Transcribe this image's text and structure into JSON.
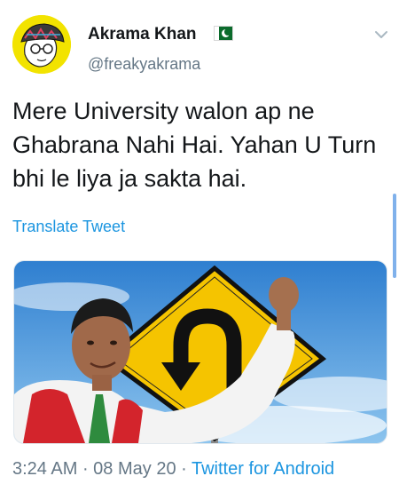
{
  "author": {
    "display_name": "Akrama Khan",
    "handle": "@freakyakrama",
    "flag_icon": "pakistan-flag-icon"
  },
  "tweet": {
    "text": "Mere University walon ap ne Ghabrana Nahi Hai. Yahan U Turn bhi le liya ja sakta hai.",
    "translate_label": "Translate Tweet"
  },
  "meta": {
    "time": "3:24 AM",
    "date": "08 May 20",
    "source": "Twitter for Android"
  },
  "colors": {
    "link": "#1b95e0",
    "secondary_text": "#657786",
    "avatar_bg": "#f2e300",
    "sign_yellow": "#f5c400"
  }
}
